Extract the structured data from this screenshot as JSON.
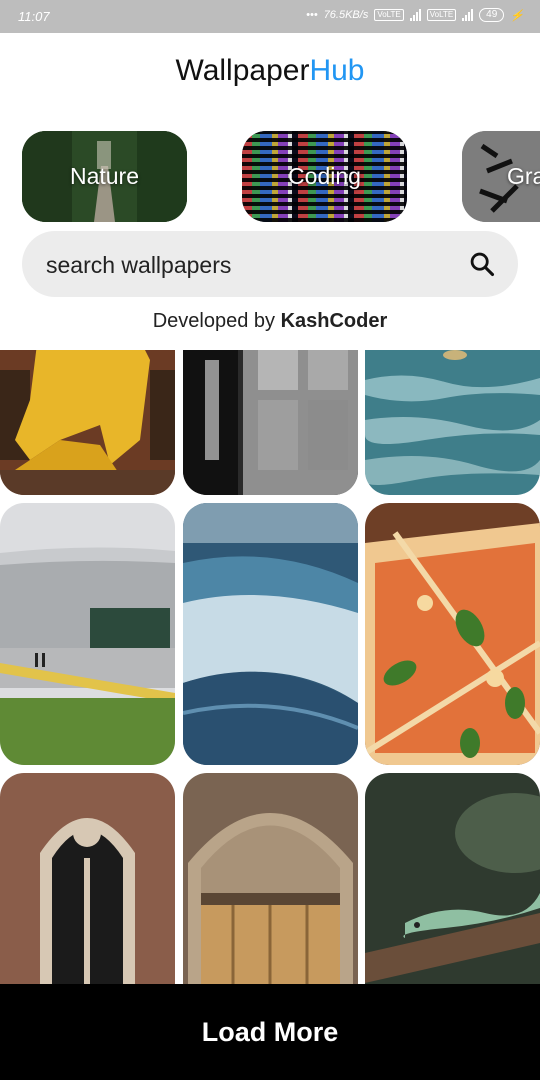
{
  "status_bar": {
    "time": "11:07",
    "network_speed": "76.5KB/s",
    "volte_label": "VoLTE",
    "battery": "49"
  },
  "app": {
    "title_part1": "Wallpaper",
    "title_part2": "Hub",
    "accent_color": "#2196f3"
  },
  "categories": [
    {
      "label": "Nature"
    },
    {
      "label": "Coding"
    },
    {
      "label": "Gra"
    }
  ],
  "search": {
    "placeholder": "search wallpapers",
    "icon": "search-icon"
  },
  "developer": {
    "prefix": "Developed by ",
    "name": "KashCoder"
  },
  "wallpapers": [
    {
      "subject": "person-in-yellow-suit"
    },
    {
      "subject": "black-white-door"
    },
    {
      "subject": "sea-water"
    },
    {
      "subject": "modern-building"
    },
    {
      "subject": "ocean-wave"
    },
    {
      "subject": "pizza"
    },
    {
      "subject": "gothic-window"
    },
    {
      "subject": "wooden-arched-door"
    },
    {
      "subject": "lizard-on-branch"
    }
  ],
  "load_more_label": "Load More"
}
